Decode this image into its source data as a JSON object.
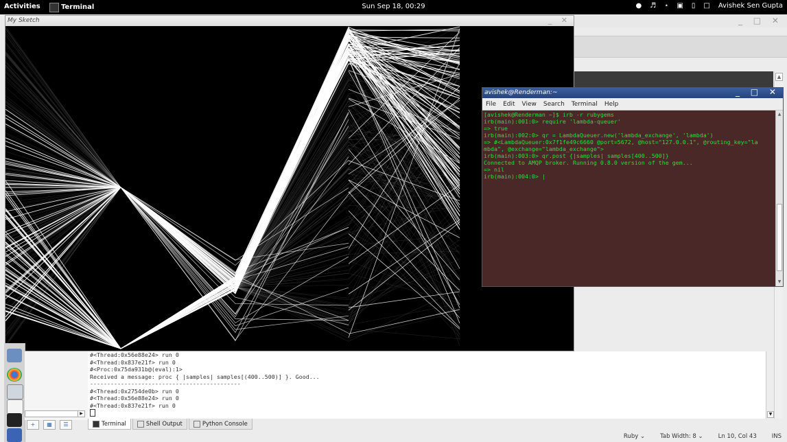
{
  "topbar": {
    "activities": "Activities",
    "app_name": "Terminal",
    "clock": "Sun Sep 18, 00:29",
    "user": "Avishek Sen Gupta"
  },
  "sketch_window": {
    "title": "My Sketch"
  },
  "terminal_window": {
    "title": "avishek@Renderman:~",
    "menu": [
      "File",
      "Edit",
      "View",
      "Search",
      "Terminal",
      "Help"
    ],
    "lines": [
      "[avishek@Renderman ~]$ irb -r rubygems",
      "irb(main):001:0> require 'lambda-queuer'",
      "=> true",
      "irb(main):002:0> qr = LambdaQueuer.new('lambda_exchange', 'lambda')",
      "=> #<LambdaQueuer:0x7f1fe49c6660 @port=5672, @host=\"127.0.0.1\", @routing_key=\"la",
      "mbda\", @exchange=\"lambda_exchange\">",
      "irb(main):003:0> qr.post {|samples| samples[400..500]}",
      "Connected to AMQP broker. Running 0.8.0 version of the gem...",
      "=> nil",
      "irb(main):004:0> |"
    ]
  },
  "console": {
    "lines": [
      "#<Thread:0x56e88e24> run 0",
      "#<Thread:0x837e21f> run 0",
      "#<Proc:0x75da931b@(eval):1>",
      "Received a message: proc { |samples| samples[(400..500)] }. Good...",
      "--------------------------------------------",
      "#<Thread:0x2754de0b> run 0",
      "#<Thread:0x56e88e24> run 0",
      "#<Thread:0x837e21f> run 0"
    ]
  },
  "tabs": [
    {
      "label": "Terminal",
      "active": true
    },
    {
      "label": "Shell Output",
      "active": false
    },
    {
      "label": "Python Console",
      "active": false
    }
  ],
  "status": {
    "language": "Ruby ⌄",
    "tab_width": "Tab Width: 8 ⌄",
    "position": "Ln 10, Col 43",
    "mode": "INS"
  }
}
